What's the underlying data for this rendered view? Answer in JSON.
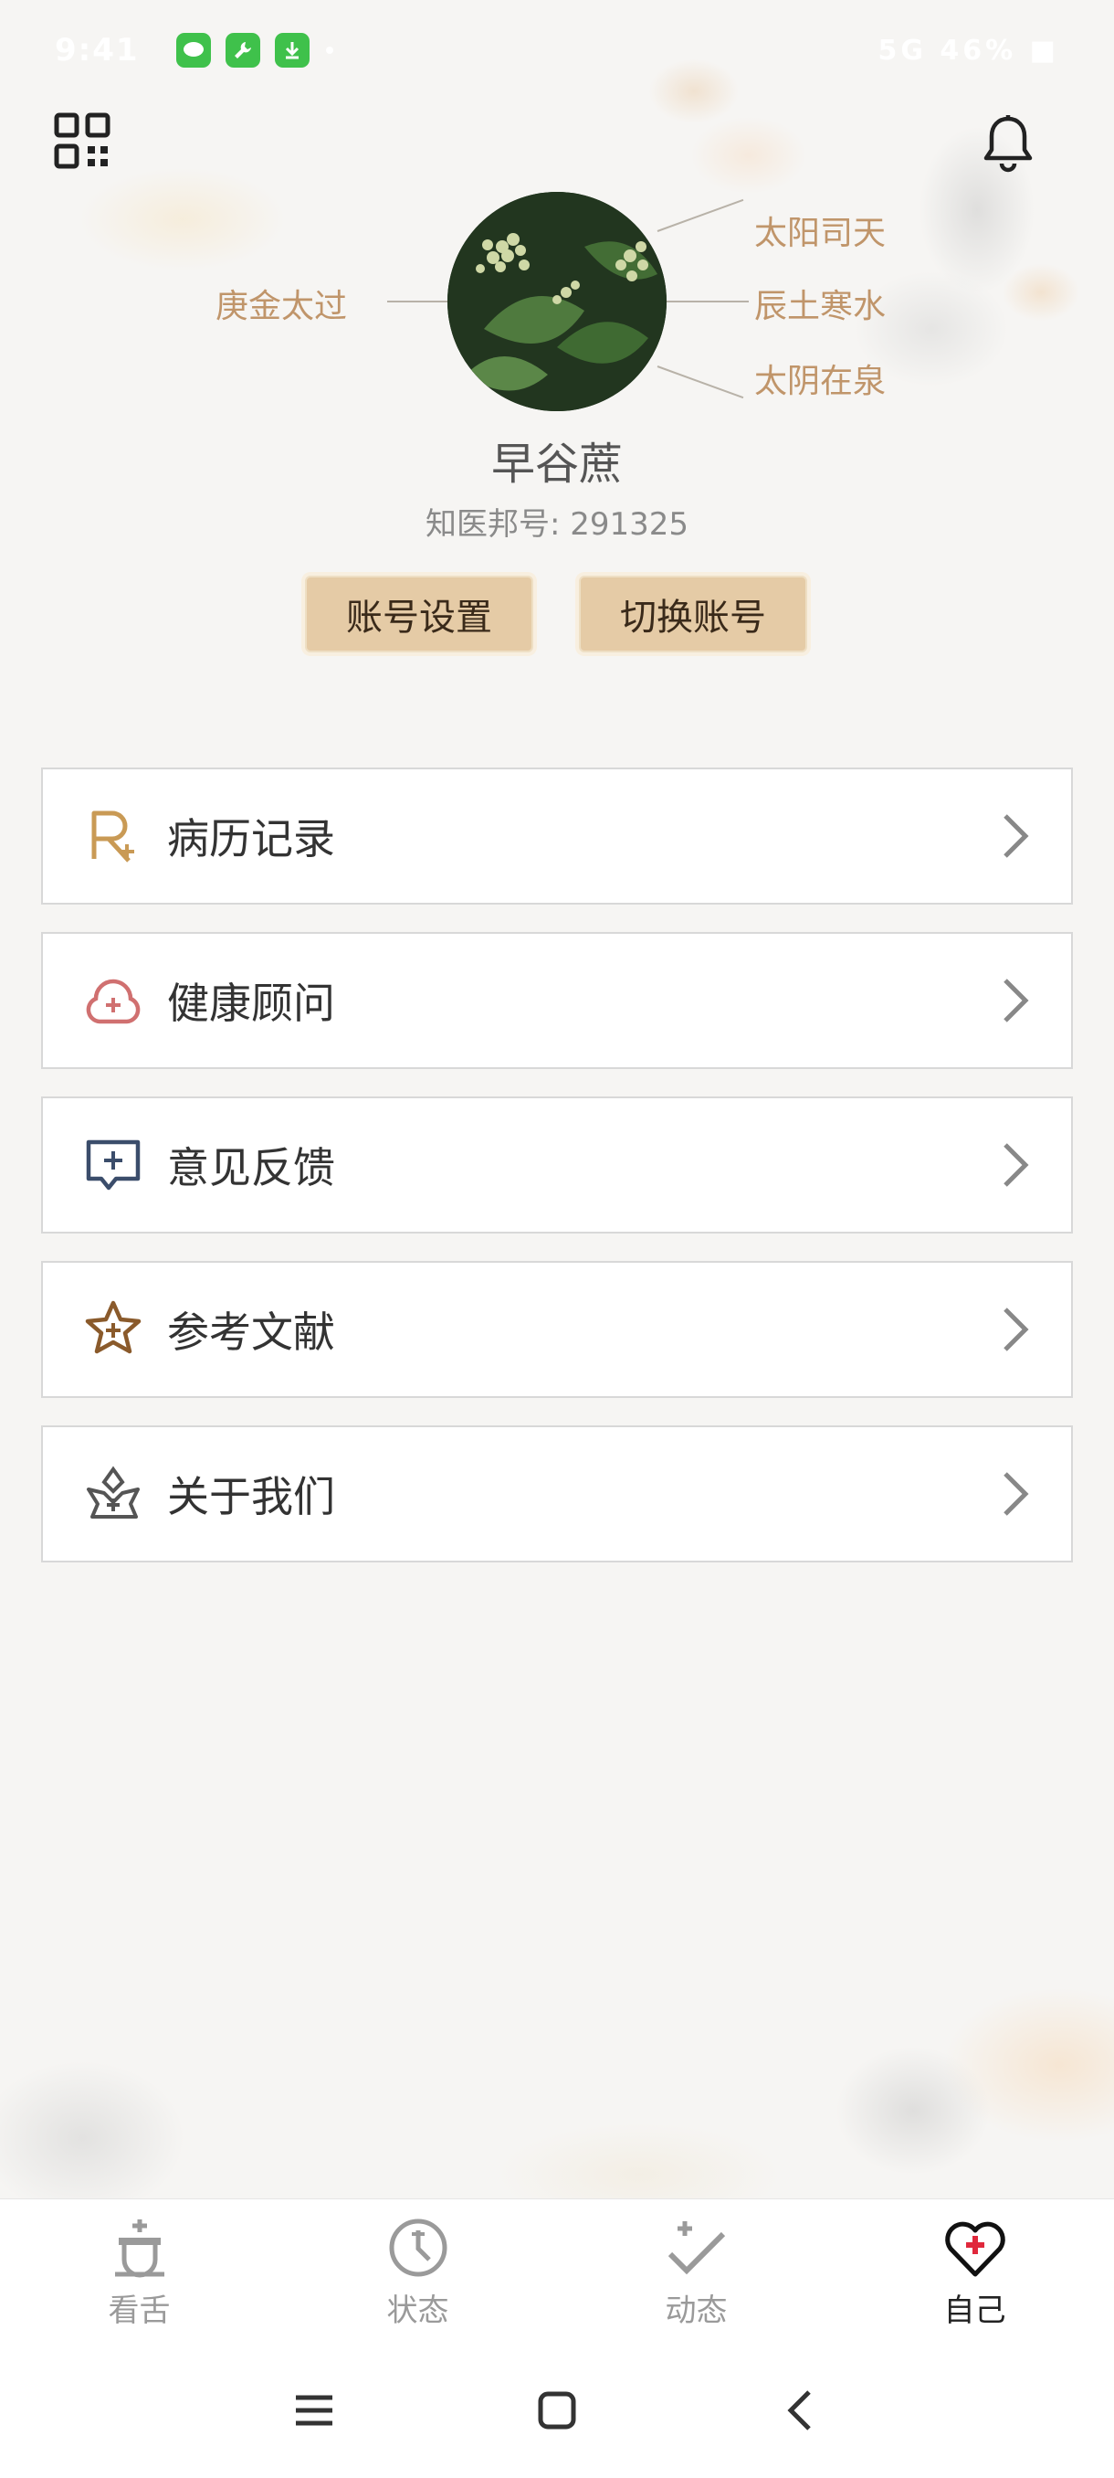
{
  "status_bar": {
    "time": "9:41",
    "right_text": "5G 46% ■",
    "app_icons": [
      {
        "icon": "message-app-icon",
        "color": "#3fc14b"
      },
      {
        "icon": "wrench-app-icon",
        "color": "#3fc14b"
      },
      {
        "icon": "download-app-icon",
        "color": "#3fc14b"
      }
    ]
  },
  "header": {
    "qr_icon": "qr-code-icon",
    "bell_icon": "bell-icon"
  },
  "profile": {
    "left_tag": "庚金太过",
    "right_tags": [
      "太阳司天",
      "辰土寒水",
      "太阴在泉"
    ],
    "username": "早谷蔗",
    "id_label": "知医邦号:",
    "id_value": "291325",
    "buttons": {
      "settings": "账号设置",
      "switch": "切换账号"
    }
  },
  "menu": [
    {
      "label": "病历记录",
      "icon": "prescription-icon",
      "color": "#c99a55"
    },
    {
      "label": "健康顾问",
      "icon": "health-cloud-icon",
      "color": "#d07070"
    },
    {
      "label": "意见反馈",
      "icon": "feedback-icon",
      "color": "#3b4d6b"
    },
    {
      "label": "参考文献",
      "icon": "star-reference-icon",
      "color": "#8a5a2b"
    },
    {
      "label": "关于我们",
      "icon": "about-lotus-icon",
      "color": "#555555"
    }
  ],
  "bottom_nav": [
    {
      "label": "看舌",
      "icon": "tongue-icon",
      "active": false
    },
    {
      "label": "状态",
      "icon": "status-clock-icon",
      "active": false
    },
    {
      "label": "动态",
      "icon": "activity-check-icon",
      "active": false
    },
    {
      "label": "自己",
      "icon": "heart-plus-icon",
      "active": true
    }
  ],
  "colors": {
    "accent_gold": "#c0956a",
    "button_bg": "#e5cba6",
    "active_red": "#e0283c"
  }
}
